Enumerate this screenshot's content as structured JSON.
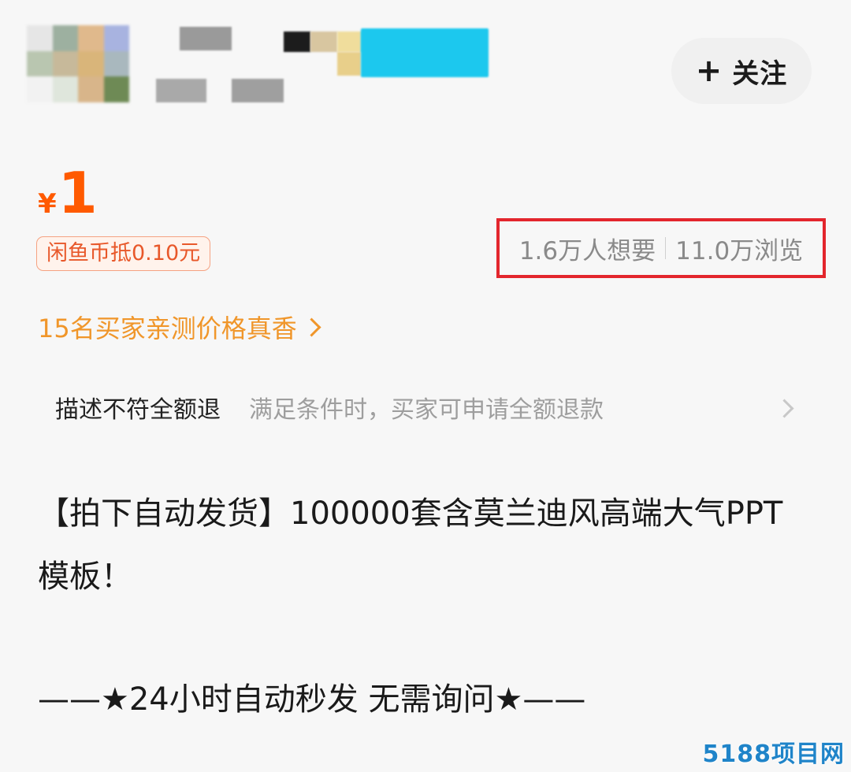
{
  "header": {
    "follow_label": "关注",
    "mosaic_colors": [
      "#e6e6e6",
      "#9db0a0",
      "#e0b98c",
      "#a8b3e0",
      "#b9c6b0",
      "#c7b99a",
      "#d9b57a",
      "#a9b8be",
      "#f2f2f2",
      "#dfe6dc",
      "#d8b58a",
      "#6e8a55"
    ],
    "name_blur_colors": [
      "#1c1c1c",
      "#d8c6a0",
      "#f0dd9c",
      "#86d8c9",
      "#1cc8ee"
    ],
    "blur_gray": "#a7a7a7"
  },
  "price": {
    "currency": "¥",
    "amount": "1",
    "coin_discount": "闲鱼币抵0.10元"
  },
  "stats": {
    "wants": "1.6万人想要",
    "views": "11.0万浏览"
  },
  "buyers_note": "15名买家亲测价格真香",
  "guarantee": {
    "title": "描述不符全额退",
    "description": "满足条件时，买家可申请全额退款"
  },
  "item": {
    "title": "【拍下自动发货】100000套含莫兰迪风高端大气PPT模板！",
    "description": "——★24小时自动秒发 无需询问★——"
  },
  "watermark": "5188项目网",
  "colors": {
    "price": "#ff5a00",
    "buyers_note": "#f0962a",
    "highlight_box": "#e3262d",
    "watermark": "#1f84c9"
  }
}
